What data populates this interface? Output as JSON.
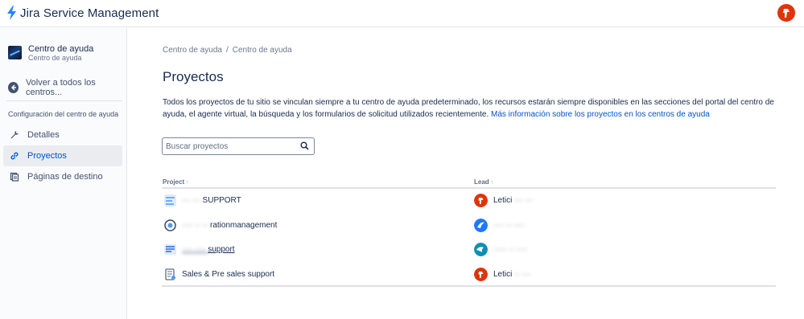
{
  "app": {
    "name": "Jira Service Management",
    "brand_color": "#2684ff"
  },
  "sidebar": {
    "help_center_title": "Centro de ayuda",
    "help_center_subtitle": "Centro de ayuda",
    "back_label": "Volver a todos los centros...",
    "section_title": "Configuración del centro de ayuda",
    "items": [
      {
        "label": "Detalles",
        "icon": "wrench-icon",
        "active": false
      },
      {
        "label": "Proyectos",
        "icon": "link-icon",
        "active": true
      },
      {
        "label": "Páginas de destino",
        "icon": "page-icon",
        "active": false
      }
    ]
  },
  "breadcrumb": [
    "Centro de ayuda",
    "Centro de ayuda"
  ],
  "page_title": "Proyectos",
  "description": {
    "text": "Todos los proyectos de tu sitio se vinculan siempre a tu centro de ayuda predeterminado, los recursos estarán siempre disponibles en las secciones del portal del centro de ayuda, el agente virtual, la búsqueda y los formularios de solicitud utilizados recientemente. ",
    "link": "Más información sobre los proyectos en los centros de ayuda"
  },
  "search": {
    "placeholder": "Buscar proyectos",
    "value": ""
  },
  "table": {
    "columns": [
      "Project",
      "Lead"
    ],
    "sort_glyph": "↑",
    "rows": [
      {
        "project": "SUPPORT",
        "lead": "Letici",
        "project_color": "#4c9aff",
        "lead_color": "#de350b"
      },
      {
        "project": "rationmanagement",
        "lead": "",
        "project_color": "#344563",
        "lead_color": "#1d7afc"
      },
      {
        "project": "support",
        "lead": "",
        "project_color": "#0052cc",
        "lead_color": "#0b8fb5"
      },
      {
        "project": "Sales & Pre sales support",
        "lead": "Letici",
        "project_color": "#5e6c84",
        "lead_color": "#de350b"
      }
    ]
  },
  "colors": {
    "accent": "#0052cc",
    "text": "#172b4d",
    "muted": "#6b778c",
    "avatar_red": "#de350b"
  }
}
